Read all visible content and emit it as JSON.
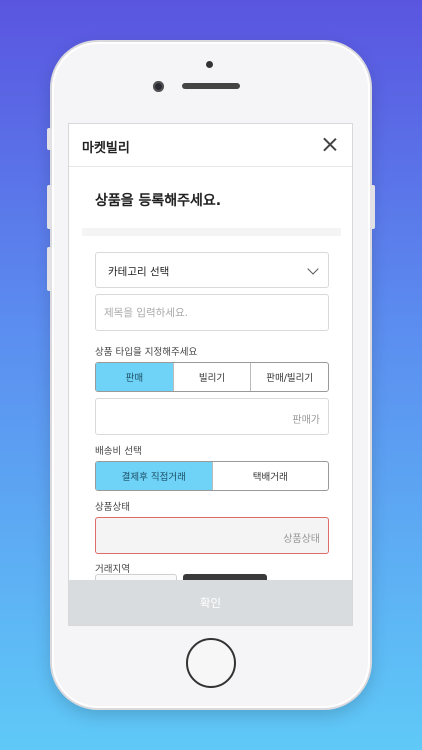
{
  "app": {
    "title": "마켓빌리"
  },
  "form": {
    "heading": "상품을 등록해주세요.",
    "category": {
      "value": "카테고리 선택"
    },
    "title_input": {
      "placeholder": "제목을 입력하세요."
    },
    "product_type": {
      "label": "상품 타입을 지정해주세요",
      "options": [
        "판매",
        "빌리기",
        "판매/빌리기"
      ],
      "selected": "판매"
    },
    "price": {
      "placeholder": "판매가"
    },
    "shipping": {
      "label": "배송비 선택",
      "options": [
        "결제후 직접거래",
        "택배거래"
      ],
      "selected": "결제후 직접거래"
    },
    "condition": {
      "label": "상품상태",
      "placeholder": "상품상태"
    },
    "region": {
      "label": "거래지역"
    },
    "confirm_label": "확인"
  },
  "colors": {
    "background_top": "#5a55e0",
    "background_bottom": "#5fc9f7",
    "active_segment": "#6fd3f7",
    "error_border": "#e06b6b",
    "confirm_bg": "#d9dcdf"
  }
}
